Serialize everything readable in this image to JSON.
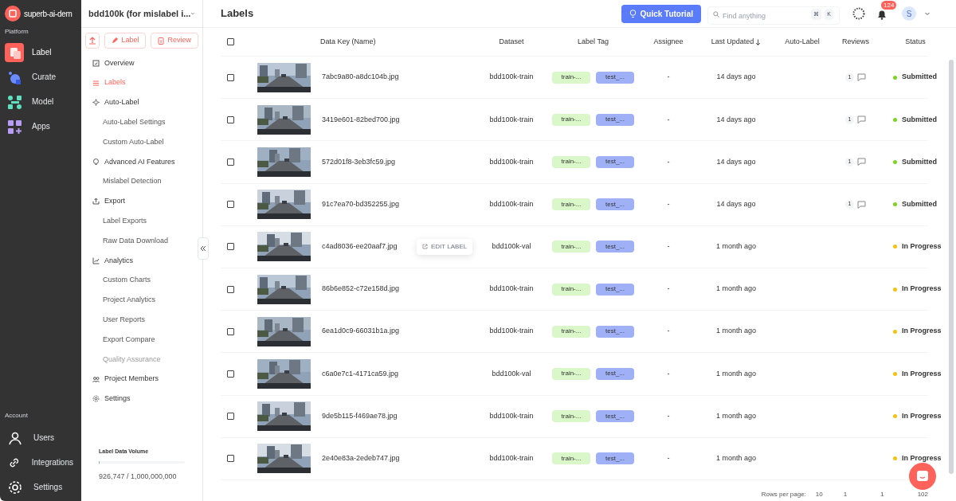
{
  "workspace": {
    "name": "superb-ai-dem"
  },
  "platform_heading": "Platform",
  "platform_nav": [
    {
      "label": "Label",
      "selected": true
    },
    {
      "label": "Curate",
      "selected": false
    },
    {
      "label": "Model",
      "selected": false
    },
    {
      "label": "Apps",
      "selected": false
    }
  ],
  "account_heading": "Account",
  "account_nav": [
    {
      "label": "Users"
    },
    {
      "label": "Integrations"
    },
    {
      "label": "Settings"
    }
  ],
  "project": {
    "name": "bdd100k (for mislabel i..."
  },
  "project_actions": [
    {
      "kind": "upload"
    },
    {
      "kind": "label",
      "label": "Label"
    },
    {
      "kind": "review",
      "label": "Review"
    }
  ],
  "project_nav": [
    {
      "label": "Overview",
      "kind": "section",
      "selected": false,
      "disabled": false
    },
    {
      "label": "Labels",
      "kind": "section",
      "selected": true,
      "disabled": false
    },
    {
      "label": "Auto-Label",
      "kind": "section",
      "selected": false,
      "disabled": false
    },
    {
      "label": "Auto-Label Settings",
      "selected": false,
      "disabled": false
    },
    {
      "label": "Custom Auto-Label",
      "selected": false,
      "disabled": false
    },
    {
      "label": "Advanced AI Features",
      "kind": "section",
      "selected": false,
      "disabled": false
    },
    {
      "label": "Mislabel Detection",
      "selected": false,
      "disabled": false
    },
    {
      "label": "Export",
      "kind": "section",
      "selected": false,
      "disabled": false
    },
    {
      "label": "Label Exports",
      "selected": false,
      "disabled": false
    },
    {
      "label": "Raw Data Download",
      "selected": false,
      "disabled": false
    },
    {
      "label": "Analytics",
      "kind": "section",
      "selected": false,
      "disabled": false
    },
    {
      "label": "Custom Charts",
      "selected": false,
      "disabled": false
    },
    {
      "label": "Project Analytics",
      "selected": false,
      "disabled": false
    },
    {
      "label": "User Reports",
      "selected": false,
      "disabled": false
    },
    {
      "label": "Export Compare",
      "selected": false,
      "disabled": false
    },
    {
      "label": "Quality Assurance",
      "selected": false,
      "disabled": true
    },
    {
      "label": "Project Members",
      "kind": "section",
      "selected": false,
      "disabled": false
    },
    {
      "label": "Settings",
      "kind": "section",
      "selected": false,
      "disabled": false
    }
  ],
  "volume": {
    "title": "Label Data Volume",
    "used": "926,747",
    "separator": "/",
    "limit": "1,000,000,000",
    "level": 0.001
  },
  "page_title": "Labels",
  "tutorial_button": "Quick Tutorial",
  "search": {
    "placeholder": "Find anything",
    "keys": [
      "⌘",
      "K"
    ]
  },
  "notifications": {
    "count": "124"
  },
  "avatar": "S",
  "table": {
    "columns": [
      {
        "label": "Data Key (Name)",
        "sorted": false
      },
      {
        "label": "Dataset",
        "sorted": false
      },
      {
        "label": "Label Tag",
        "sorted": false
      },
      {
        "label": "Assignee",
        "sorted": false
      },
      {
        "label": "Last Updated",
        "sorted": true
      },
      {
        "label": "Auto-Label",
        "sorted": false
      },
      {
        "label": "Reviews",
        "sorted": false
      },
      {
        "label": "Status",
        "sorted": false
      }
    ],
    "select_all_checked": false,
    "rows": [
      {
        "name": "7abc9a80-a8dc104b.jpg",
        "dataset": "bdd100k-train",
        "tags": [
          {
            "label": "train-...",
            "color": "#d9f7c8"
          },
          {
            "label": "test_...",
            "color": "#9fb0f7"
          }
        ],
        "assignee": "-",
        "updated": "14 days ago",
        "reviews": "1",
        "status": "Submitted",
        "color": "#7ed321",
        "checked": false
      },
      {
        "name": "3419e601-82bed700.jpg",
        "dataset": "bdd100k-train",
        "tags": [
          {
            "label": "train-...",
            "color": "#d9f7c8"
          },
          {
            "label": "test_...",
            "color": "#9fb0f7"
          }
        ],
        "assignee": "-",
        "updated": "14 days ago",
        "reviews": "1",
        "status": "Submitted",
        "color": "#7ed321",
        "checked": false
      },
      {
        "name": "572d01f8-3eb3fc59.jpg",
        "dataset": "bdd100k-train",
        "tags": [
          {
            "label": "train-...",
            "color": "#d9f7c8"
          },
          {
            "label": "test_...",
            "color": "#9fb0f7"
          }
        ],
        "assignee": "-",
        "updated": "14 days ago",
        "reviews": "1",
        "status": "Submitted",
        "color": "#7ed321",
        "checked": false
      },
      {
        "name": "91c7ea70-bd352255.jpg",
        "dataset": "bdd100k-train",
        "tags": [
          {
            "label": "train-...",
            "color": "#d9f7c8"
          },
          {
            "label": "test_...",
            "color": "#9fb0f7"
          }
        ],
        "assignee": "-",
        "updated": "14 days ago",
        "reviews": "1",
        "status": "Submitted",
        "color": "#7ed321",
        "checked": false
      },
      {
        "name": "c4ad8036-ee20aaf7.jpg",
        "dataset": "bdd100k-val",
        "tags": [
          {
            "label": "train-...",
            "color": "#d9f7c8"
          },
          {
            "label": "test_...",
            "color": "#9fb0f7"
          }
        ],
        "assignee": "-",
        "updated": "1 month ago",
        "status": "In Progress",
        "color": "#f5c211",
        "checked": false,
        "hover_action": "EDIT LABEL"
      },
      {
        "name": "86b6e852-c72e158d.jpg",
        "dataset": "bdd100k-train",
        "tags": [
          {
            "label": "train-...",
            "color": "#d9f7c8"
          },
          {
            "label": "test_...",
            "color": "#9fb0f7"
          }
        ],
        "assignee": "-",
        "updated": "1 month ago",
        "status": "In Progress",
        "color": "#f5c211",
        "checked": false
      },
      {
        "name": "6ea1d0c9-66031b1a.jpg",
        "dataset": "bdd100k-train",
        "tags": [
          {
            "label": "train-...",
            "color": "#d9f7c8"
          },
          {
            "label": "test_...",
            "color": "#9fb0f7"
          }
        ],
        "assignee": "-",
        "updated": "1 month ago",
        "status": "In Progress",
        "color": "#f5c211",
        "checked": false
      },
      {
        "name": "c6a0e7c1-4171ca59.jpg",
        "dataset": "bdd100k-val",
        "tags": [
          {
            "label": "train-...",
            "color": "#d9f7c8"
          },
          {
            "label": "test_...",
            "color": "#9fb0f7"
          }
        ],
        "assignee": "-",
        "updated": "1 month ago",
        "status": "In Progress",
        "color": "#f5c211",
        "checked": false
      },
      {
        "name": "9de5b115-f469ae78.jpg",
        "dataset": "bdd100k-train",
        "tags": [
          {
            "label": "train-...",
            "color": "#d9f7c8"
          },
          {
            "label": "test_...",
            "color": "#9fb0f7"
          }
        ],
        "assignee": "-",
        "updated": "1 month ago",
        "status": "In Progress",
        "color": "#f5c211",
        "checked": false
      },
      {
        "name": "2e40e83a-2edeb747.jpg",
        "dataset": "bdd100k-train",
        "tags": [
          {
            "label": "train-...",
            "color": "#d9f7c8"
          },
          {
            "label": "test_...",
            "color": "#9fb0f7"
          }
        ],
        "assignee": "-",
        "updated": "1 month ago",
        "status": "In Progress",
        "color": "#f5c211",
        "checked": false
      }
    ]
  },
  "pagination": {
    "rows_label": "Rows per page:",
    "rows_value": "10",
    "page": "1",
    "current": "1",
    "total": "102"
  }
}
